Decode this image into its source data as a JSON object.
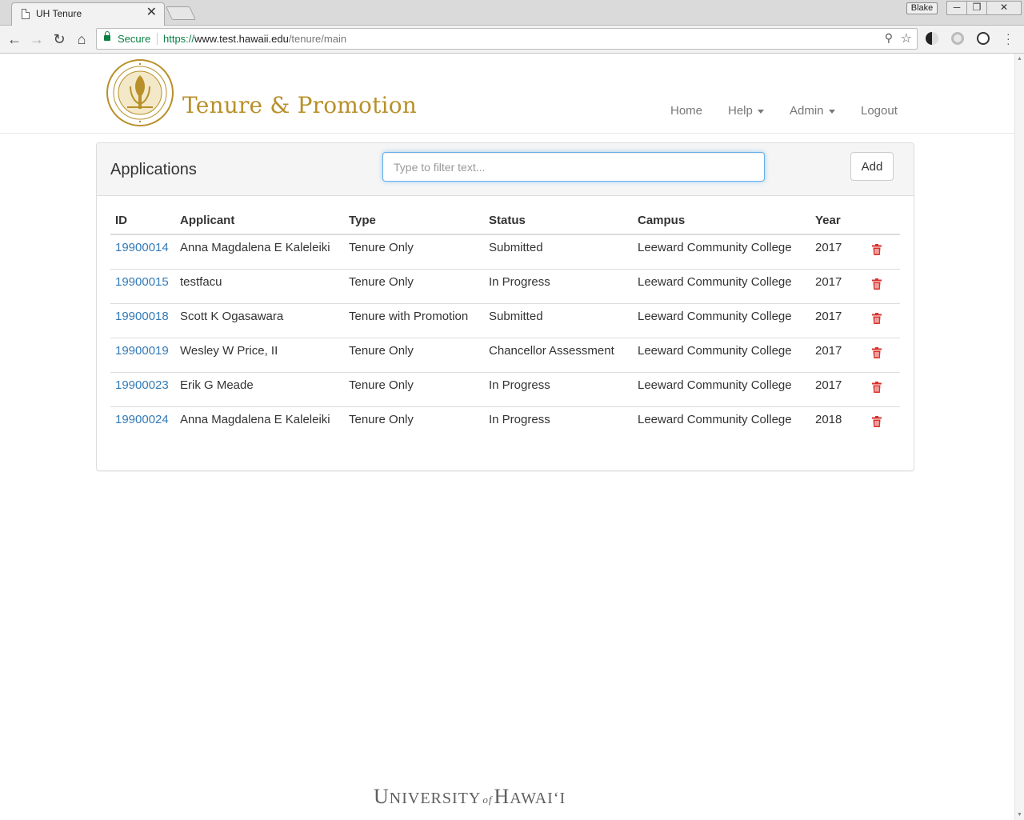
{
  "browser": {
    "tab_title": "UH Tenure",
    "tab_close": "✕",
    "profile_name": "Blake",
    "secure_label": "Secure",
    "url_scheme": "https://",
    "url_host": "www.test.hawaii.edu",
    "url_path": "/tenure/main"
  },
  "header": {
    "site_title": "Tenure & Promotion",
    "nav": {
      "home": "Home",
      "help": "Help",
      "admin": "Admin",
      "logout": "Logout"
    }
  },
  "panel": {
    "title": "Applications",
    "filter_placeholder": "Type to filter text...",
    "add_label": "Add"
  },
  "table": {
    "columns": [
      "ID",
      "Applicant",
      "Type",
      "Status",
      "Campus",
      "Year"
    ],
    "rows": [
      {
        "id": "19900014",
        "applicant": "Anna Magdalena E Kaleleiki",
        "type": "Tenure Only",
        "status": "Submitted",
        "campus": "Leeward Community College",
        "year": "2017"
      },
      {
        "id": "19900015",
        "applicant": "testfacu",
        "type": "Tenure Only",
        "status": "In Progress",
        "campus": "Leeward Community College",
        "year": "2017"
      },
      {
        "id": "19900018",
        "applicant": "Scott K Ogasawara",
        "type": "Tenure with Promotion",
        "status": "Submitted",
        "campus": "Leeward Community College",
        "year": "2017"
      },
      {
        "id": "19900019",
        "applicant": "Wesley W Price, II",
        "type": "Tenure Only",
        "status": "Chancellor Assessment",
        "campus": "Leeward Community College",
        "year": "2017"
      },
      {
        "id": "19900023",
        "applicant": "Erik G Meade",
        "type": "Tenure Only",
        "status": "In Progress",
        "campus": "Leeward Community College",
        "year": "2017"
      },
      {
        "id": "19900024",
        "applicant": "Anna Magdalena E Kaleleiki",
        "type": "Tenure Only",
        "status": "In Progress",
        "campus": "Leeward Community College",
        "year": "2018"
      }
    ]
  },
  "footer": {
    "logo_u": "U",
    "logo_niversity": "NIVERSITY",
    "logo_of": "of",
    "logo_h": "H",
    "logo_awaii": "AWAIʻI"
  },
  "colors": {
    "brand_gold": "#b8902a",
    "link": "#337ab7",
    "danger": "#d9302c"
  },
  "icons": {
    "delete": "trash-icon",
    "seal": "uh-seal-logo"
  }
}
